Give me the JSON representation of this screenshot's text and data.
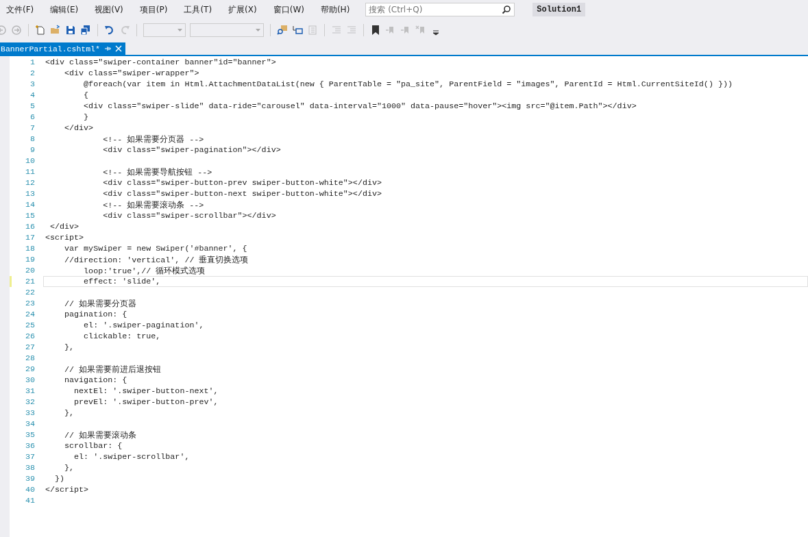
{
  "menu": [
    "文件(F)",
    "编辑(E)",
    "视图(V)",
    "项目(P)",
    "工具(T)",
    "扩展(X)",
    "窗口(W)",
    "帮助(H)"
  ],
  "search": {
    "placeholder": "搜索 (Ctrl+Q)"
  },
  "solution": "Solution1",
  "toolbar": [
    {
      "kind": "back",
      "disabled": true
    },
    {
      "kind": "forward",
      "disabled": true
    },
    {
      "kind": "sep"
    },
    {
      "kind": "new",
      "disabled": false
    },
    {
      "kind": "open",
      "disabled": false
    },
    {
      "kind": "save",
      "disabled": false
    },
    {
      "kind": "saveall",
      "disabled": false
    },
    {
      "kind": "sep"
    },
    {
      "kind": "undo",
      "disabled": false
    },
    {
      "kind": "redo",
      "disabled": true
    },
    {
      "kind": "sep"
    },
    {
      "kind": "combo",
      "disabled": true
    },
    {
      "kind": "combo-wide",
      "disabled": true
    },
    {
      "kind": "sep"
    },
    {
      "kind": "find",
      "disabled": false
    },
    {
      "kind": "select",
      "disabled": false
    },
    {
      "kind": "indent",
      "disabled": true
    },
    {
      "kind": "sep"
    },
    {
      "kind": "comment",
      "disabled": true
    },
    {
      "kind": "uncomment",
      "disabled": true
    },
    {
      "kind": "sep"
    },
    {
      "kind": "bookmark",
      "disabled": false
    },
    {
      "kind": "prevbm",
      "disabled": true
    },
    {
      "kind": "nextbm",
      "disabled": true
    },
    {
      "kind": "clearbm",
      "disabled": true
    },
    {
      "kind": "more",
      "disabled": false
    }
  ],
  "tabs": [
    {
      "label": "BannerPartial.cshtml*",
      "selected": true
    }
  ],
  "editor": {
    "lines": [
      {
        "number": "1",
        "text": "<div class=\"swiper-container banner\"id=\"banner\">",
        "current": false
      },
      {
        "number": "2",
        "text": "    <div class=\"swiper-wrapper\">",
        "current": false
      },
      {
        "number": "3",
        "text": "        @foreach(var item in Html.AttachmentDataList(new { ParentTable = \"pa_site\", ParentField = \"images\", ParentId = Html.CurrentSiteId() }))",
        "current": false
      },
      {
        "number": "4",
        "text": "        {",
        "current": false
      },
      {
        "number": "5",
        "text": "        <div class=\"swiper-slide\" data-ride=\"carousel\" data-interval=\"1000\" data-pause=\"hover\"><img src=\"@item.Path\"></div>",
        "current": false
      },
      {
        "number": "6",
        "text": "        }",
        "current": false
      },
      {
        "number": "7",
        "text": "    </div>",
        "current": false
      },
      {
        "number": "8",
        "text": "            <!-- 如果需要分页器 -->",
        "current": false
      },
      {
        "number": "9",
        "text": "            <div class=\"swiper-pagination\"></div>",
        "current": false
      },
      {
        "number": "10",
        "current": false
      },
      {
        "number": "11",
        "text": "            <!-- 如果需要导航按钮 -->",
        "current": false
      },
      {
        "number": "12",
        "text": "            <div class=\"swiper-button-prev swiper-button-white\"></div>",
        "current": false
      },
      {
        "number": "13",
        "text": "            <div class=\"swiper-button-next swiper-button-white\"></div>",
        "current": false
      },
      {
        "number": "14",
        "text": "            <!-- 如果需要滚动条 -->",
        "current": false
      },
      {
        "number": "15",
        "text": "            <div class=\"swiper-scrollbar\"></div>",
        "current": false
      },
      {
        "number": "16",
        "text": " </div>",
        "current": false
      },
      {
        "number": "17",
        "text": "<script>",
        "current": false
      },
      {
        "number": "18",
        "text": "    var mySwiper = new Swiper('#banner', {",
        "current": false
      },
      {
        "number": "19",
        "text": "    //direction: 'vertical', // 垂直切换选项",
        "current": false
      },
      {
        "number": "20",
        "text": "        loop:'true',// 循环模式选项",
        "current": false
      },
      {
        "number": "21",
        "text": "        effect: 'slide',",
        "current": true
      },
      {
        "number": "22",
        "current": false
      },
      {
        "number": "23",
        "text": "    // 如果需要分页器",
        "current": false
      },
      {
        "number": "24",
        "text": "    pagination: {",
        "current": false
      },
      {
        "number": "25",
        "text": "        el: '.swiper-pagination',",
        "current": false
      },
      {
        "number": "26",
        "text": "        clickable: true,",
        "current": false
      },
      {
        "number": "27",
        "text": "    },",
        "current": false
      },
      {
        "number": "28",
        "current": false
      },
      {
        "number": "29",
        "text": "    // 如果需要前进后退按钮",
        "current": false
      },
      {
        "number": "30",
        "text": "    navigation: {",
        "current": false
      },
      {
        "number": "31",
        "text": "      nextEl: '.swiper-button-next',",
        "current": false
      },
      {
        "number": "32",
        "text": "      prevEl: '.swiper-button-prev',",
        "current": false
      },
      {
        "number": "33",
        "text": "    },",
        "current": false
      },
      {
        "number": "34",
        "current": false
      },
      {
        "number": "35",
        "text": "    // 如果需要滚动条",
        "current": false
      },
      {
        "number": "36",
        "text": "    scrollbar: {",
        "current": false
      },
      {
        "number": "37",
        "text": "      el: '.swiper-scrollbar',",
        "current": false
      },
      {
        "number": "38",
        "text": "    },",
        "current": false
      },
      {
        "number": "39",
        "text": "  })",
        "current": false
      },
      {
        "number": "40",
        "text": "</script>",
        "current": false
      },
      {
        "number": "41",
        "current": false
      }
    ]
  }
}
